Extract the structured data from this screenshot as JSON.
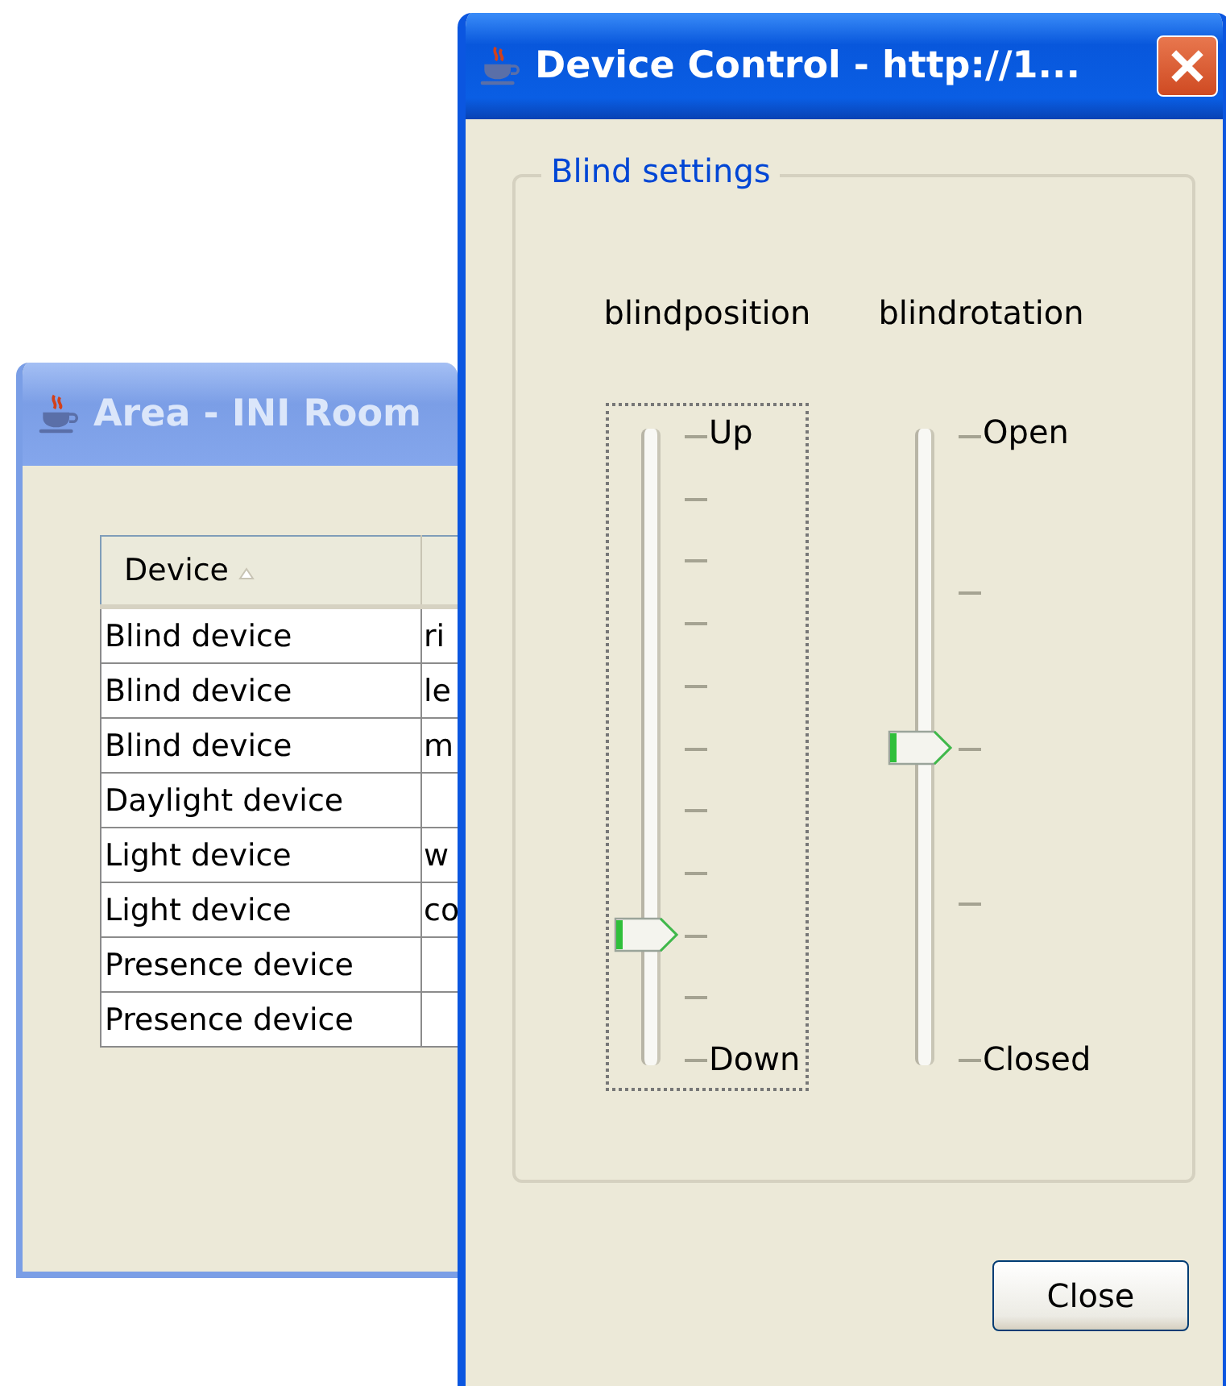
{
  "back_window": {
    "title": "Area - INI Room",
    "active": false,
    "table": {
      "columns": [
        {
          "label": "Device",
          "sorted": true
        },
        {}
      ],
      "rows": [
        {
          "cells": [
            "Blind device",
            "ri"
          ]
        },
        {
          "cells": [
            "Blind device",
            "le"
          ]
        },
        {
          "cells": [
            "Blind device",
            "m"
          ]
        },
        {
          "cells": [
            "Daylight device",
            ""
          ]
        },
        {
          "cells": [
            "Light device",
            "w"
          ]
        },
        {
          "cells": [
            "Light device",
            "co"
          ]
        },
        {
          "cells": [
            "Presence device",
            ""
          ]
        },
        {
          "cells": [
            "Presence device",
            ""
          ]
        }
      ]
    }
  },
  "front_window": {
    "title": "Device Control - http://1...",
    "active": true,
    "group": {
      "legend": "Blind settings",
      "sliders": [
        {
          "name": "blindposition",
          "top_label": "Up",
          "bottom_label": "Down",
          "level": 0.2,
          "focused": true
        },
        {
          "name": "blindrotation",
          "top_label": "Open",
          "bottom_label": "Closed",
          "level": 0.5,
          "focused": false
        }
      ]
    },
    "buttons": [
      "Close"
    ]
  }
}
